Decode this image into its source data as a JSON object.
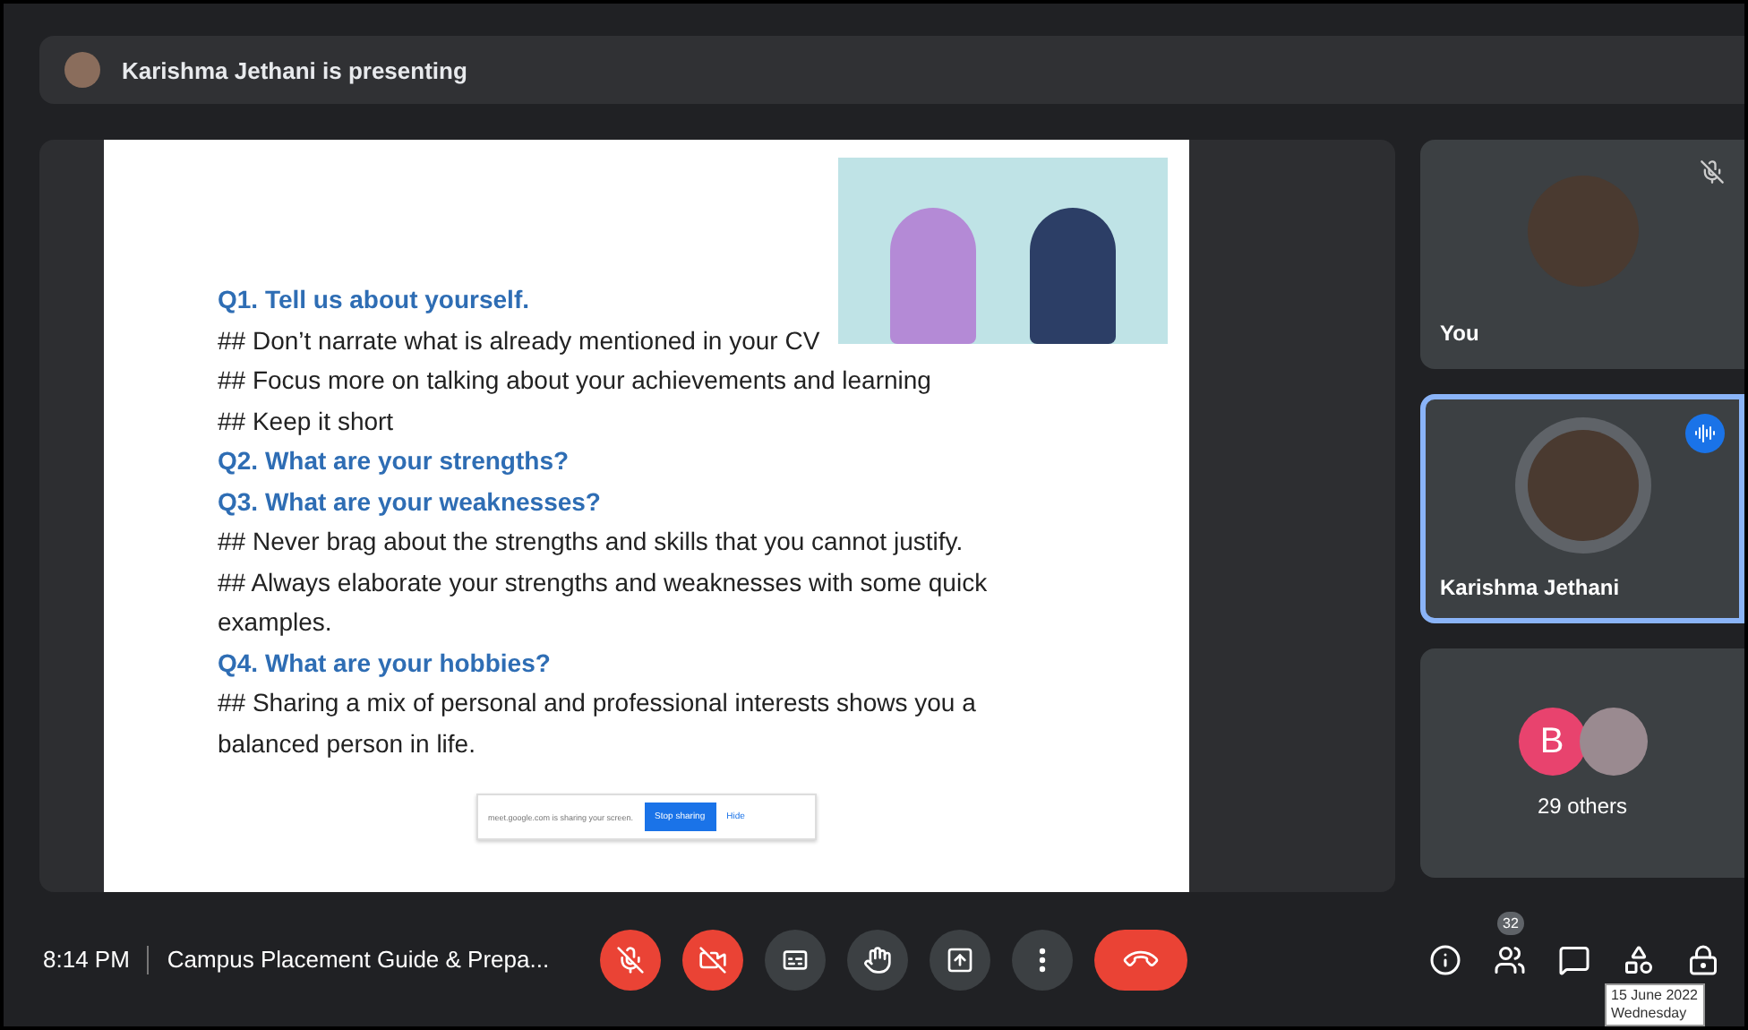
{
  "banner": {
    "text": "Karishma Jethani is presenting"
  },
  "slide": {
    "lines": [
      {
        "kind": "question",
        "text": "Q1. Tell us about yourself."
      },
      {
        "kind": "note",
        "text": "## Don’t narrate what is already mentioned in your CV"
      },
      {
        "kind": "note",
        "text": "## Focus more on talking about your achievements and learning"
      },
      {
        "kind": "note",
        "text": "## Keep it short"
      },
      {
        "kind": "question",
        "text": "Q2. What are your strengths?"
      },
      {
        "kind": "question",
        "text": "Q3. What are your weaknesses?"
      },
      {
        "kind": "note",
        "text": "## Never brag about the strengths and skills that you cannot justify."
      },
      {
        "kind": "note",
        "text": "## Always elaborate your strengths and weaknesses with some quick examples."
      },
      {
        "kind": "question",
        "text": "Q4. What are your hobbies?"
      },
      {
        "kind": "note",
        "text": "## Sharing a mix of personal and professional interests shows you a balanced person in life."
      }
    ],
    "share_bar": {
      "message": "meet.google.com is sharing your screen.",
      "stop": "Stop sharing",
      "hide": "Hide"
    }
  },
  "tiles": [
    {
      "kind": "person",
      "name": "You",
      "muted": true,
      "speaking": false
    },
    {
      "kind": "person",
      "name": "Karishma Jethani",
      "muted": false,
      "speaking": true
    },
    {
      "kind": "others",
      "letter": "B",
      "name": "29 others"
    }
  ],
  "bottom": {
    "time": "8:14 PM",
    "title": "Campus Placement Guide & Prepa...",
    "controls": [
      {
        "kind": "mic",
        "on": false
      },
      {
        "kind": "camera",
        "on": false
      },
      {
        "kind": "captions"
      },
      {
        "kind": "hand"
      },
      {
        "kind": "present"
      },
      {
        "kind": "more"
      },
      {
        "kind": "leave"
      }
    ],
    "people_count": "32",
    "tooltip": {
      "date": "15 June 2022",
      "day": "Wednesday"
    }
  }
}
